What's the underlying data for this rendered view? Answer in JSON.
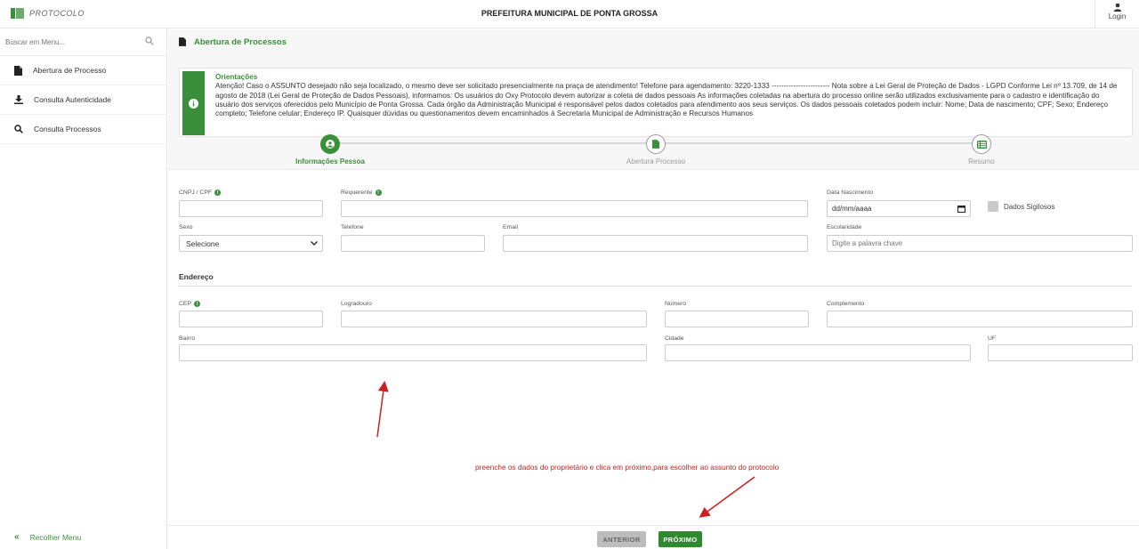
{
  "header": {
    "logo_text": "PROTOCOLO",
    "org_title": "PREFEITURA MUNICIPAL DE PONTA GROSSA",
    "login_label": "Login",
    "accent_color": "#3a8f3a"
  },
  "sidebar": {
    "search_placeholder": "Buscar em Menu...",
    "items": [
      {
        "label": "Abertura de Processo",
        "icon": "file-icon"
      },
      {
        "label": "Consulta Autenticidade",
        "icon": "download-icon"
      },
      {
        "label": "Consulta Processos",
        "icon": "search-icon"
      }
    ],
    "collapse_label": "Recolher Menu"
  },
  "page": {
    "title": "Abertura de Processos"
  },
  "alert": {
    "title": "Orientações",
    "text": "Atenção! Caso o ASSUNTO desejado não seja localizado, o mesmo deve ser solicitado presencialmente na praça de atendimento! Telefone para agendamento: 3220-1333 ------------------------ Nota sobre a Lei Geral de Proteção de Dados - LGPD Conforme Lei nº 13.709, de 14 de agosto de 2018 (Lei Geral de Proteção de Dados Pessoais), informamos: Os usuários do Oxy Protocolo devem autorizar a coleta de dados pessoais As informações coletadas na abertura do processo online serão utilizados exclusivamente para o cadastro e identificação do usuário dos serviços oferecidos pelo Município de Ponta Grossa. Cada órgão da Administração Municipal é responsável pelos dados coletados para atendimento aos seus serviços. Os dados pessoais coletados podem incluir: Nome; Data de nascimento; CPF; Sexo; Endereço completo; Telefone celular; Endereço IP. Quaisquer dúvidas ou questionamentos devem encaminhados à Secretaria Municipal de Administração e Recursos Humanos"
  },
  "stepper": {
    "steps": [
      {
        "label": "Informações Pessoa",
        "icon": "user-icon",
        "state": "active"
      },
      {
        "label": "Abertura Processo",
        "icon": "file-icon",
        "state": "pending"
      },
      {
        "label": "Resumo",
        "icon": "list-icon",
        "state": "pending"
      }
    ]
  },
  "form": {
    "cpf_label": "CNPJ / CPF",
    "requerente_label": "Requerente",
    "nascimento_label": "Data Nascimento",
    "nascimento_value": "dd/mm/aaaa",
    "sigilosos_label": "Dados Sigilosos",
    "sexo_label": "Sexo",
    "sexo_value": "Selecione",
    "telefone_label": "Telefone",
    "email_label": "Email",
    "escolaridade_label": "Escolaridade",
    "escolaridade_placeholder": "Digite a palavra chave",
    "endereco_title": "Endereço",
    "cep_label": "CEP",
    "logradouro_label": "Logradouro",
    "numero_label": "Número",
    "complemento_label": "Complemento",
    "bairro_label": "Bairro",
    "cidade_label": "Cidade",
    "uf_label": "UF"
  },
  "annotation": {
    "text": "preenche os dados do proprietário e clica em próximo,para escolher ao assunto do protocolo",
    "color": "#cc1f1f"
  },
  "footer": {
    "prev_label": "ANTERIOR",
    "next_label": "PRÓXIMO"
  }
}
